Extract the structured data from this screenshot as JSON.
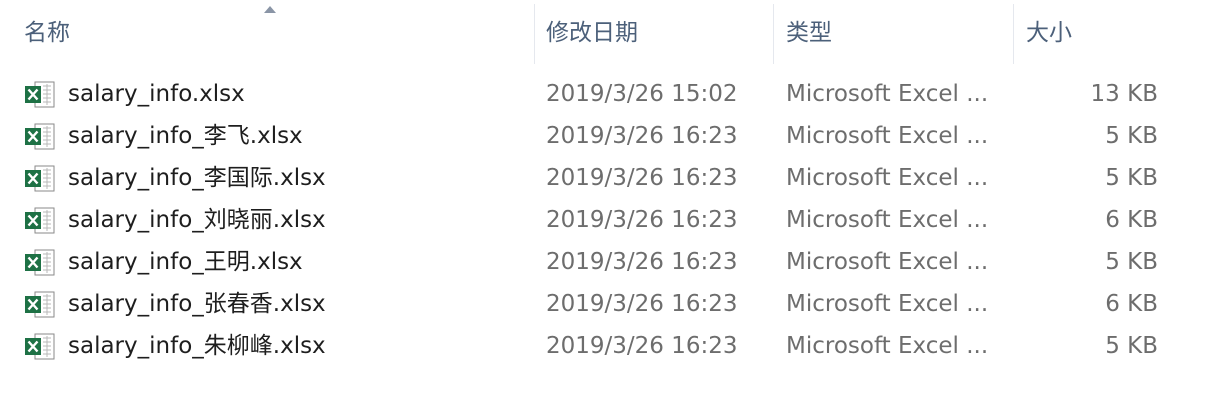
{
  "columns": {
    "name": "名称",
    "date": "修改日期",
    "type": "类型",
    "size": "大小"
  },
  "sort": {
    "column": "name",
    "direction": "ascending",
    "icon": "sort-up-arrow-icon"
  },
  "file_icon": "excel-file-icon",
  "colors": {
    "header_text": "#4c607a",
    "excel_green": "#1e7145",
    "secondary_text": "#6d6d6d"
  },
  "files": [
    {
      "name": "salary_info.xlsx",
      "modified": "2019/3/26 15:02",
      "type": "Microsoft Excel ...",
      "size": "13 KB"
    },
    {
      "name": "salary_info_李飞.xlsx",
      "modified": "2019/3/26 16:23",
      "type": "Microsoft Excel ...",
      "size": "5 KB"
    },
    {
      "name": "salary_info_李国际.xlsx",
      "modified": "2019/3/26 16:23",
      "type": "Microsoft Excel ...",
      "size": "5 KB"
    },
    {
      "name": "salary_info_刘晓丽.xlsx",
      "modified": "2019/3/26 16:23",
      "type": "Microsoft Excel ...",
      "size": "6 KB"
    },
    {
      "name": "salary_info_王明.xlsx",
      "modified": "2019/3/26 16:23",
      "type": "Microsoft Excel ...",
      "size": "5 KB"
    },
    {
      "name": "salary_info_张春香.xlsx",
      "modified": "2019/3/26 16:23",
      "type": "Microsoft Excel ...",
      "size": "6 KB"
    },
    {
      "name": "salary_info_朱柳峰.xlsx",
      "modified": "2019/3/26 16:23",
      "type": "Microsoft Excel ...",
      "size": "5 KB"
    }
  ]
}
